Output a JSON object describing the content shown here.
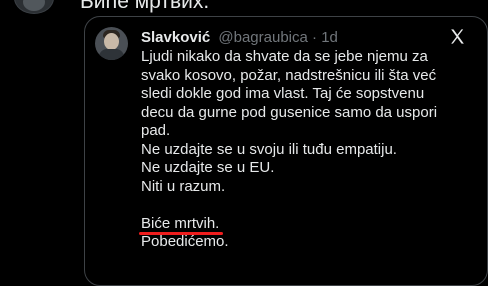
{
  "outer_post": {
    "text": "Биће мртвих."
  },
  "quoted_post": {
    "author_name": "Slavković",
    "handle": "@bagraubica",
    "separator": "·",
    "time": "1d",
    "lines": [
      "Ljudi nikako da shvate da se jebe njemu za",
      "svako kosovo, požar, nadstrešnicu ili šta već",
      "sledi dokle god ima vlast. Taj će sopstvenu",
      "decu da gurne pod gusenice samo da uspori",
      "pad.",
      "Ne uzdajte se u svoju ili tuđu empatiju.",
      "Ne uzdajte se u EU.",
      "Niti u razum."
    ],
    "highlighted_line": "Biće mrtvih.",
    "final_line": "Pobedićemo."
  },
  "icons": {
    "avatar_icon": "user-avatar",
    "platform_icon": "x-logo-icon"
  },
  "colors": {
    "background": "#000000",
    "text": "#e7e9ea",
    "muted": "#71767b",
    "border": "#3e4246",
    "highlight_underline": "#ef1d1d"
  }
}
